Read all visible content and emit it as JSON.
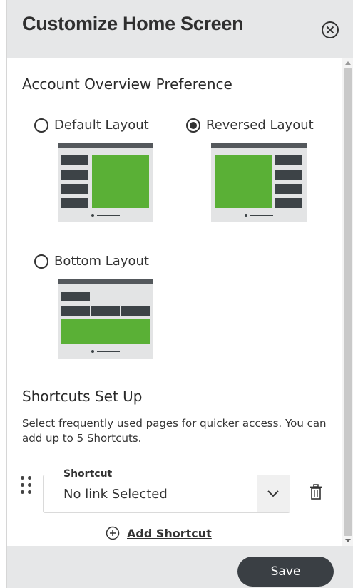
{
  "header": {
    "title": "Customize Home Screen",
    "close_icon": "close-circle-icon"
  },
  "account_overview": {
    "title": "Account Overview Preference",
    "options": [
      {
        "label": "Default Layout",
        "selected": false
      },
      {
        "label": "Reversed Layout",
        "selected": true
      },
      {
        "label": "Bottom Layout",
        "selected": false
      }
    ]
  },
  "shortcuts": {
    "title": "Shortcuts Set Up",
    "description": "Select frequently used pages for quicker access. You can add up to 5 Shortcuts.",
    "field_label": "Shortcut",
    "field_value": "No link Selected",
    "add_label": "Add Shortcut"
  },
  "footer": {
    "save_label": "Save"
  },
  "colors": {
    "accent_green": "#5ab036",
    "dark": "#3a3f44",
    "header_bg": "#e6e7e8"
  }
}
